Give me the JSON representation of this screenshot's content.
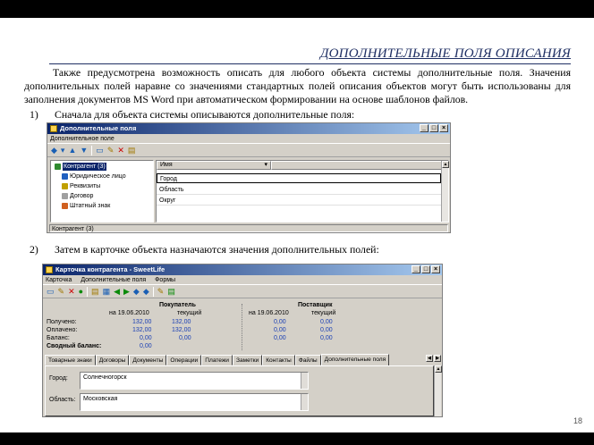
{
  "slide": {
    "title": "ДОПОЛНИТЕЛЬНЫЕ ПОЛЯ ОПИСАНИЯ",
    "intro": "Также предусмотрена возможность описать для любого объекта системы дополнительные поля. Значения дополнительных полей наравне со значениями стандартных полей описания объектов могут быть использованы для заполнения документов MS Word при автоматическом формировании на основе шаблонов файлов.",
    "step1_num": "1)",
    "step1_text": "Сначала для объекта системы описываются дополнительные поля:",
    "step2_num": "2)",
    "step2_text": "Затем в карточке объекта назначаются значения дополнительных полей:",
    "page_number": "18"
  },
  "window1": {
    "title": "Дополнительные поля",
    "menu": [
      "Дополнительное поле"
    ],
    "tree": [
      "Контрагент (3)",
      "Юридическое лицо",
      "Реквизиты",
      "Договор",
      "Штатный знак"
    ],
    "grid_header": "Имя",
    "grid_rows": [
      "Город",
      "Область",
      "Округ"
    ],
    "status": "Контрагент (3)",
    "colors": {
      "titlebar": "#0a246a",
      "chrome": "#d4d0c8"
    }
  },
  "window2": {
    "title": "Карточка контрагента - SweetLife",
    "menu": [
      "Карточка",
      "Дополнительные поля",
      "Формы"
    ],
    "buyer": {
      "header": "Покупатель",
      "col1": "на 19.06.2010",
      "col2": "текущий"
    },
    "supplier": {
      "header": "Поставщик",
      "col1": "на 19.06.2010",
      "col2": "текущий"
    },
    "rows": [
      {
        "label": "Получено:",
        "b1": "132,00",
        "b2": "132,00",
        "s1": "0,00",
        "s2": "0,00"
      },
      {
        "label": "Оплачено:",
        "b1": "132,00",
        "b2": "132,00",
        "s1": "0,00",
        "s2": "0,00"
      },
      {
        "label": "Баланс:",
        "b1": "0,00",
        "b2": "0,00",
        "s1": "0,00",
        "s2": "0,00"
      },
      {
        "label": "Сводный баланс:",
        "b1": "0,00",
        "b2": "",
        "s1": "",
        "s2": ""
      }
    ],
    "tabs": [
      "Товарные знаки",
      "Договоры",
      "Документы",
      "Операции",
      "Платежи",
      "Заметки",
      "Контакты",
      "Файлы",
      "Дополнительные поля"
    ],
    "active_tab": "Дополнительные поля",
    "fields": [
      {
        "label": "Город:",
        "value": "Солнечногорск"
      },
      {
        "label": "Область:",
        "value": "Московская"
      }
    ]
  }
}
